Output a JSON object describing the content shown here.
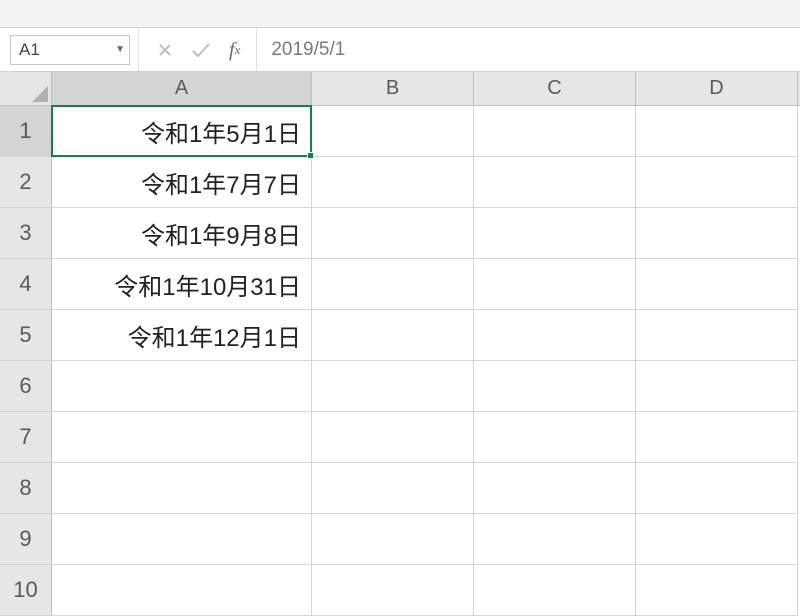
{
  "nameBox": {
    "value": "A1"
  },
  "formulaBar": {
    "value": "2019/5/1"
  },
  "columns": [
    {
      "label": "A",
      "cls": "col-A",
      "selected": true
    },
    {
      "label": "B",
      "cls": "col-B",
      "selected": false
    },
    {
      "label": "C",
      "cls": "col-C",
      "selected": false
    },
    {
      "label": "D",
      "cls": "col-D",
      "selected": false
    }
  ],
  "rows": [
    {
      "num": "1",
      "selected": true,
      "cells": [
        "令和1年5月1日",
        "",
        "",
        ""
      ]
    },
    {
      "num": "2",
      "selected": false,
      "cells": [
        "令和1年7月7日",
        "",
        "",
        ""
      ]
    },
    {
      "num": "3",
      "selected": false,
      "cells": [
        "令和1年9月8日",
        "",
        "",
        ""
      ]
    },
    {
      "num": "4",
      "selected": false,
      "cells": [
        "令和1年10月31日",
        "",
        "",
        ""
      ]
    },
    {
      "num": "5",
      "selected": false,
      "cells": [
        "令和1年12月1日",
        "",
        "",
        ""
      ]
    },
    {
      "num": "6",
      "selected": false,
      "cells": [
        "",
        "",
        "",
        ""
      ]
    },
    {
      "num": "7",
      "selected": false,
      "cells": [
        "",
        "",
        "",
        ""
      ]
    },
    {
      "num": "8",
      "selected": false,
      "cells": [
        "",
        "",
        "",
        ""
      ]
    },
    {
      "num": "9",
      "selected": false,
      "cells": [
        "",
        "",
        "",
        ""
      ]
    },
    {
      "num": "10",
      "selected": false,
      "cells": [
        "",
        "",
        "",
        ""
      ]
    }
  ],
  "activeCell": {
    "row": 0,
    "col": 0
  }
}
